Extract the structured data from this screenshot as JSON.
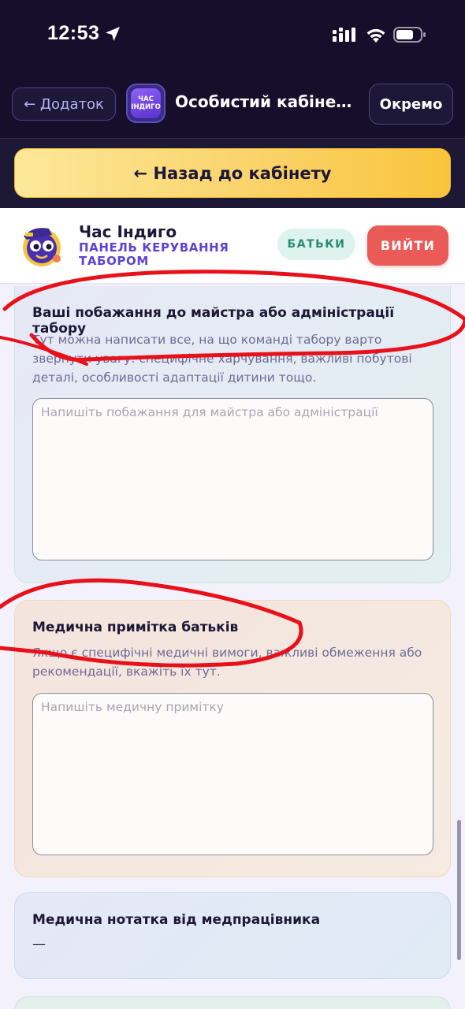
{
  "status_bar": {
    "time": "12:53",
    "icons": [
      "location-arrow-icon",
      "cellular-signal-icon",
      "wifi-icon",
      "battery-icon"
    ]
  },
  "nav": {
    "back_label": "← Додаток",
    "logo_text_line1": "ЧАС",
    "logo_text_line2": "ІНДИГО",
    "title": "Особистий кабінет к...",
    "separate_label": "Окремо"
  },
  "back_bar": {
    "label": "← Назад до кабінету"
  },
  "header": {
    "brand_name": "Час Індиго",
    "brand_sub": "ПАНЕЛЬ КЕРУВАННЯ ТАБОРОМ",
    "role_badge": "БАТЬКИ",
    "logout_label": "ВИЙТИ"
  },
  "wishes": {
    "title": "Ваші побажання до майстра або адміністрації табору",
    "description": "Тут можна написати все, на що команді табору варто звернути увагу: специфічне харчування, важливі побутові деталі, особливості адаптації дитини тощо.",
    "placeholder": "Напишіть побажання для майстра або адміністрації",
    "value": ""
  },
  "medical_note": {
    "title": "Медична примітка батьків",
    "description": "Якщо є специфічні медичні вимоги, важливі обмеження або рекомендації, вкажіть їх тут.",
    "placeholder": "Напишіть медичну примітку",
    "value": ""
  },
  "nurse_note": {
    "title": "Медична нотатка від медпрацівника",
    "value": "—"
  },
  "colors": {
    "accent_purple": "#5b44d4",
    "logout_red": "#ea5a57",
    "yellow_button": "#fad36a",
    "annotation_red": "#e8111b"
  }
}
